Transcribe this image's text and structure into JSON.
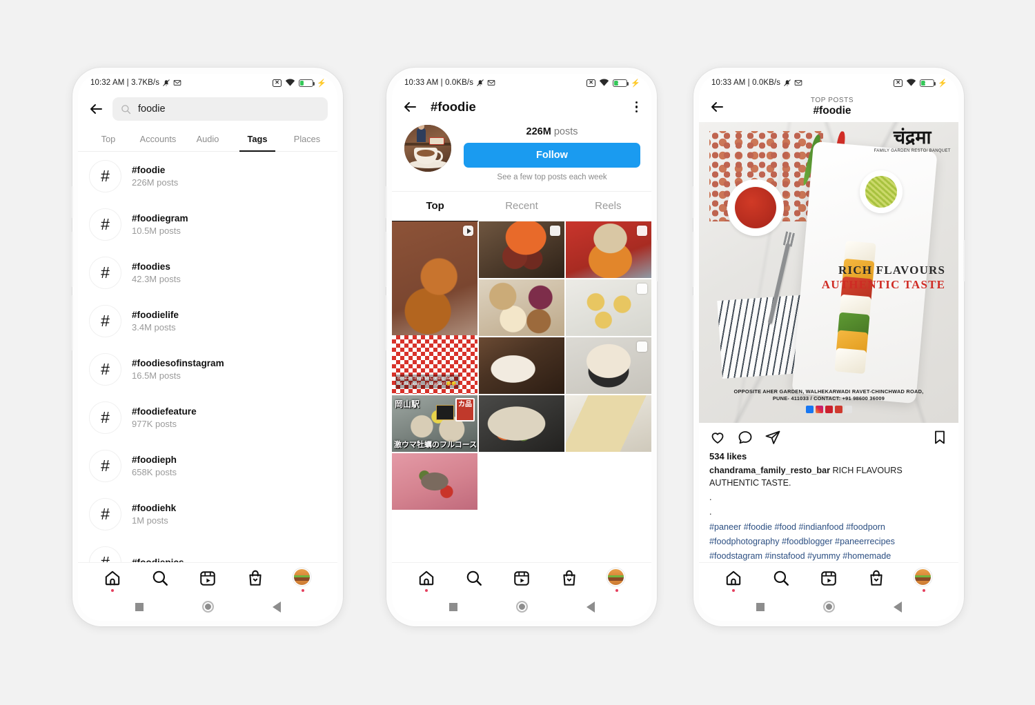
{
  "theme": {
    "background": "#f2f2f2",
    "accent_blue": "#1a9bf0",
    "link_blue": "#2c4f82",
    "notification_red": "#e4405f",
    "battery_green": "#35c759"
  },
  "phone1": {
    "status_bar": {
      "time_and_rate": "10:32 AM | 3.7KB/s",
      "battery_percent": "31",
      "icons": [
        "no-sim-icon",
        "silent-bell-icon",
        "mail-icon",
        "wifi-icon",
        "battery-icon",
        "charging-bolt-icon"
      ]
    },
    "search": {
      "value": "foodie",
      "placeholder": "Search"
    },
    "tabs": [
      {
        "label": "Top",
        "active": false
      },
      {
        "label": "Accounts",
        "active": false
      },
      {
        "label": "Audio",
        "active": false
      },
      {
        "label": "Tags",
        "active": true
      },
      {
        "label": "Places",
        "active": false
      }
    ],
    "tag_results": [
      {
        "name": "#foodie",
        "posts": "226M posts"
      },
      {
        "name": "#foodiegram",
        "posts": "10.5M posts"
      },
      {
        "name": "#foodies",
        "posts": "42.3M posts"
      },
      {
        "name": "#foodielife",
        "posts": "3.4M posts"
      },
      {
        "name": "#foodiesofinstagram",
        "posts": "16.5M posts"
      },
      {
        "name": "#foodiefeature",
        "posts": "977K posts"
      },
      {
        "name": "#foodieph",
        "posts": "658K posts"
      },
      {
        "name": "#foodiehk",
        "posts": "1M posts"
      },
      {
        "name": "#foodiepics",
        "posts": ""
      }
    ],
    "hash_glyph": "#"
  },
  "phone2": {
    "status_bar": {
      "time_and_rate": "10:33 AM | 0.0KB/s",
      "battery_percent": "32"
    },
    "header": {
      "title": "#foodie",
      "menu": "more-options-icon"
    },
    "profile": {
      "post_count_number": "226M",
      "post_count_suffix": " posts",
      "follow_label": "Follow",
      "subnote": "See a few top posts each week"
    },
    "tabs": [
      {
        "label": "Top",
        "active": true
      },
      {
        "label": "Recent",
        "active": false
      },
      {
        "label": "Reels",
        "active": false
      }
    ],
    "grid": [
      {
        "id": "fried-chicken",
        "badge": "reel",
        "overlay": "Bone-in Thigh $8\nComing back for this again...\nand again! 😋😋"
      },
      {
        "id": "korean-noodle-beef",
        "badge": "carousel",
        "overlay": ""
      },
      {
        "id": "enoki-soup",
        "badge": "carousel",
        "overlay": ""
      },
      {
        "id": "pastries-sweet-potato",
        "badge": "",
        "overlay": ""
      },
      {
        "id": "jelly-dessert",
        "badge": "carousel",
        "overlay": ""
      },
      {
        "id": "cafe-coffee",
        "badge": "",
        "overlay": ""
      },
      {
        "id": "meringue-cake",
        "badge": "carousel",
        "overlay": ""
      },
      {
        "id": "oyster-course",
        "badge": "",
        "overlay_top": "岡山駅",
        "overlay_bottom": "激ウマ牡蠣のフルコース",
        "stamp": "カ品"
      },
      {
        "id": "congee-bowl",
        "badge": "",
        "overlay": ""
      },
      {
        "id": "salmon-roll",
        "badge": "",
        "overlay": ""
      },
      {
        "id": "beef-platter",
        "badge": "",
        "overlay": ""
      }
    ]
  },
  "phone3": {
    "status_bar": {
      "time_and_rate": "10:33 AM | 0.0KB/s",
      "battery_percent": "32"
    },
    "header": {
      "toplabel": "TOP POSTS",
      "hashtag": "#foodie"
    },
    "post_image": {
      "logo_devanagari": "चंद्रमा",
      "logo_subtitle": "FAMILY GARDEN RESTO/\nBANQUET",
      "tagline_1": "RICH FLAVOURS",
      "tagline_2": "AUTHENTIC TASTE",
      "address_line_1": "OPPOSITE AHER GARDEN, WALHEKARWADI RAVET-CHINCHWAD ROAD,",
      "address_line_2": "PUNE- 411033 / CONTACT: +91 98600 36009",
      "social_icons": [
        "facebook-icon",
        "instagram-icon",
        "zomato-icon",
        "swiggy-icon",
        "google-icon"
      ]
    },
    "actions": [
      "like-icon",
      "comment-icon",
      "share-icon",
      "save-icon"
    ],
    "likes": "534 likes",
    "caption_user": "chandrama_family_resto_bar",
    "caption_text": " RICH FLAVOURS AUTHENTIC TASTE.",
    "caption_dot_1": ".",
    "caption_dot_2": ".",
    "hashtags_line_1": "#paneer #foodie #food #indianfood #foodporn",
    "hashtags_line_2": "#foodphotography #foodblogger #paneerrecipes",
    "hashtags_line_3": "#foodstagram #instafood #yummy #homemade"
  },
  "bottom_nav": {
    "items": [
      "home-icon",
      "search-icon",
      "reels-icon",
      "shop-icon",
      "profile-avatar-burger-icon"
    ]
  },
  "system_nav": {
    "items": [
      "recents-square-icon",
      "home-circle-icon",
      "back-triangle-icon"
    ]
  }
}
